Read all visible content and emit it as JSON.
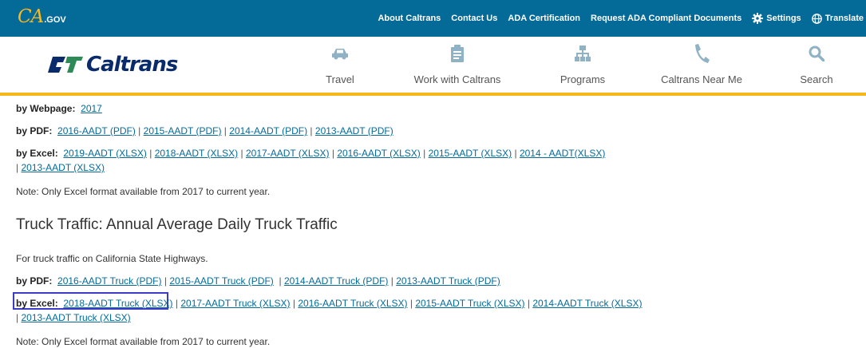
{
  "topbar": {
    "logo_text": "CA",
    "logo_suffix": ".GOV",
    "links": [
      {
        "label": "About Caltrans"
      },
      {
        "label": "Contact Us"
      },
      {
        "label": "ADA Certification"
      },
      {
        "label": "Request ADA Compliant Documents"
      },
      {
        "label": "Settings",
        "icon": "gear-icon"
      },
      {
        "label": "Translate",
        "icon": "globe-icon"
      }
    ],
    "color": "#046b99"
  },
  "brand": {
    "name": "Caltrans"
  },
  "nav": {
    "items": [
      {
        "label": "Travel",
        "icon": "car-icon"
      },
      {
        "label": "Work with Caltrans",
        "icon": "clipboard-icon"
      },
      {
        "label": "Programs",
        "icon": "sitemap-icon"
      },
      {
        "label": "Caltrans Near Me",
        "icon": "phone-icon"
      },
      {
        "label": "Search",
        "icon": "search-icon"
      }
    ],
    "accent": "#f6b519"
  },
  "aadt": {
    "webpage": {
      "label": "by Webpage:",
      "links": [
        "2017"
      ]
    },
    "pdf": {
      "label": "by PDF:",
      "links": [
        "2016-AADT (PDF)",
        "2015-AADT (PDF)",
        "2014-AADT (PDF)",
        "2013-AADT (PDF)"
      ]
    },
    "excel": {
      "label": "by Excel:",
      "links": [
        "2019-AADT (XLSX)",
        "2018-AADT (XLSX)",
        "2017-AADT (XLSX)",
        "2016-AADT (XLSX)",
        "2015-AADT (XLSX)",
        "2014 - AADT(XLSX)",
        "2013-AADT (XLSX)"
      ]
    },
    "note": "Note: Only Excel format available from 2017 to current year."
  },
  "truck": {
    "heading": "Truck Traffic: Annual Average Daily Truck Traffic",
    "intro": "For truck traffic on California State Highways.",
    "pdf": {
      "label": "by PDF:",
      "links": [
        "2016-AADT Truck (PDF)",
        "2015-AADT Truck (PDF)",
        "2014-AADT Truck (PDF)",
        "2013-AADT Truck (PDF)"
      ]
    },
    "excel": {
      "label": "by Excel:",
      "links": [
        "2018-AADT Truck (XLSX)",
        "2017-AADT Truck (XLSX)",
        "2016-AADT Truck (XLSX)",
        "2015-AADT Truck (XLSX)",
        "2014-AADT Truck (XLSX)",
        "2013-AADT Truck (XLSX)"
      ]
    },
    "note": "Note: Only Excel format available from 2017 to current year."
  }
}
